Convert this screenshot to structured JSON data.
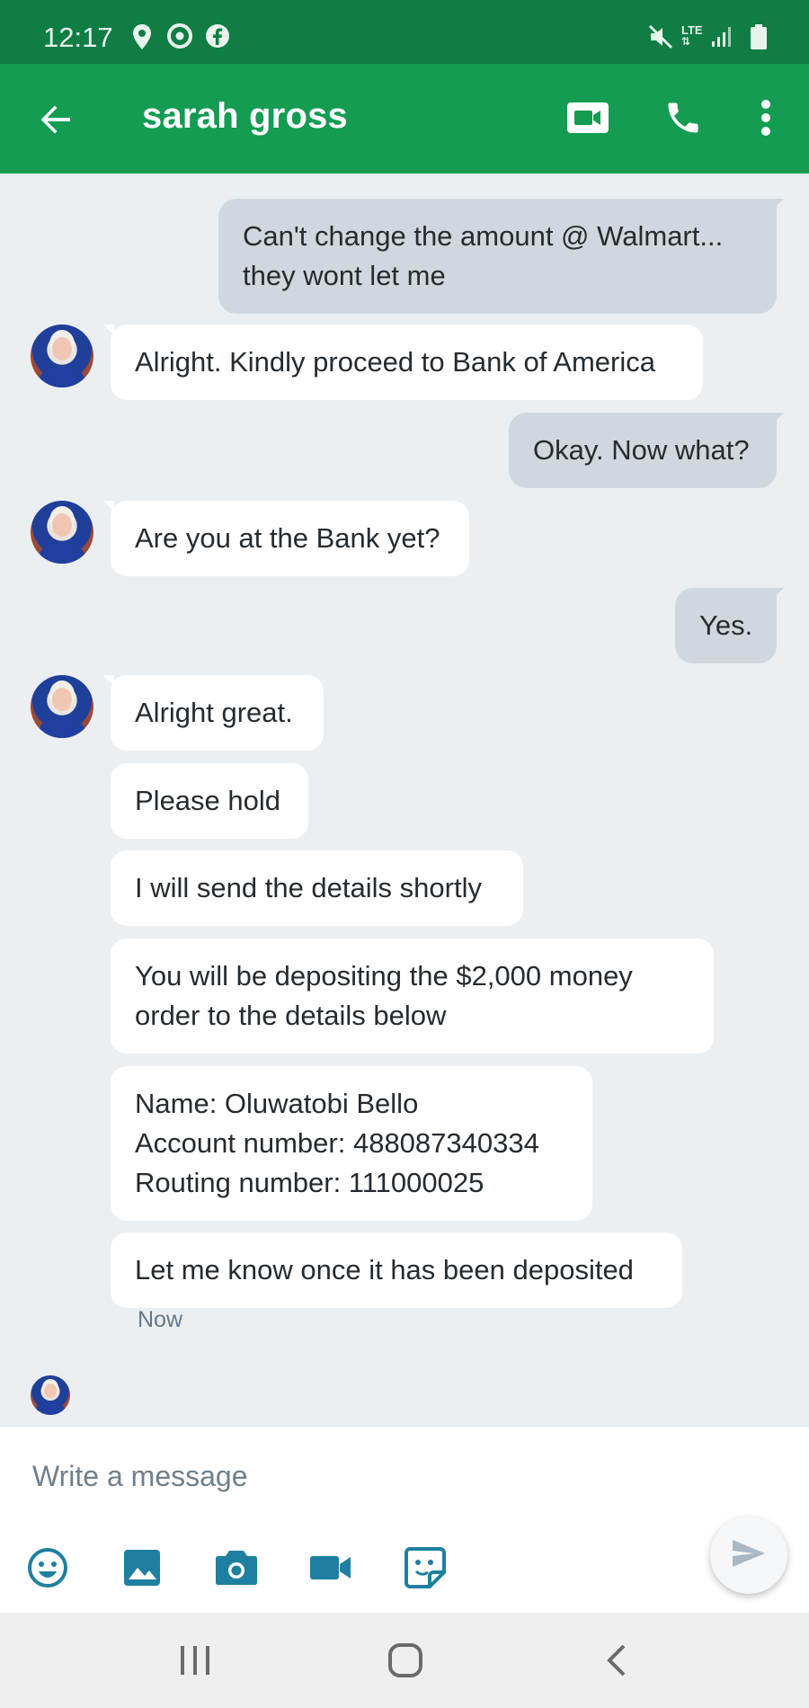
{
  "status_bar": {
    "time": "12:17",
    "network": "LTE",
    "left_icons": [
      "location-icon",
      "chrome-icon",
      "facebook-icon"
    ],
    "right_icons": [
      "mute-icon",
      "lte-icon",
      "signal-icon",
      "battery-icon"
    ]
  },
  "header": {
    "contact_name": "sarah gross",
    "icons": [
      "back-arrow-icon",
      "video-call-icon",
      "phone-icon",
      "more-vert-icon"
    ]
  },
  "messages": [
    {
      "dir": "out",
      "text": "Can't  change the amount @ Walmart...\nthey wont let me"
    },
    {
      "dir": "in",
      "text": "Alright. Kindly proceed to Bank of America"
    },
    {
      "dir": "out",
      "text": "Okay. Now what?"
    },
    {
      "dir": "in",
      "text": "Are you at the Bank yet?"
    },
    {
      "dir": "out",
      "text": "Yes."
    },
    {
      "dir": "in",
      "text": "Alright great."
    },
    {
      "dir": "in",
      "text": "Please hold"
    },
    {
      "dir": "in",
      "text": "I will send the details shortly"
    },
    {
      "dir": "in",
      "text": "You will be depositing the $2,000 money\norder to the details below"
    },
    {
      "dir": "in",
      "text": "Name: Oluwatobi Bello\nAccount number: 488087340334\nRouting number: 111000025"
    },
    {
      "dir": "in",
      "text": "Let me know once it has been deposited"
    }
  ],
  "last_timestamp": "Now",
  "compose": {
    "placeholder": "Write a message",
    "tools": [
      "emoji-icon",
      "gallery-icon",
      "camera-icon",
      "video-icon",
      "sticker-icon"
    ],
    "send_icon": "send-icon"
  },
  "nav_bar": {
    "buttons": [
      "recent-apps-icon",
      "home-icon",
      "back-nav-icon"
    ]
  },
  "colors": {
    "status_bar": "#0f7d44",
    "app_bar": "#139c52",
    "incoming_bubble": "#ffffff",
    "outgoing_bubble": "#cfd8de",
    "chat_background": "#eceff2"
  }
}
